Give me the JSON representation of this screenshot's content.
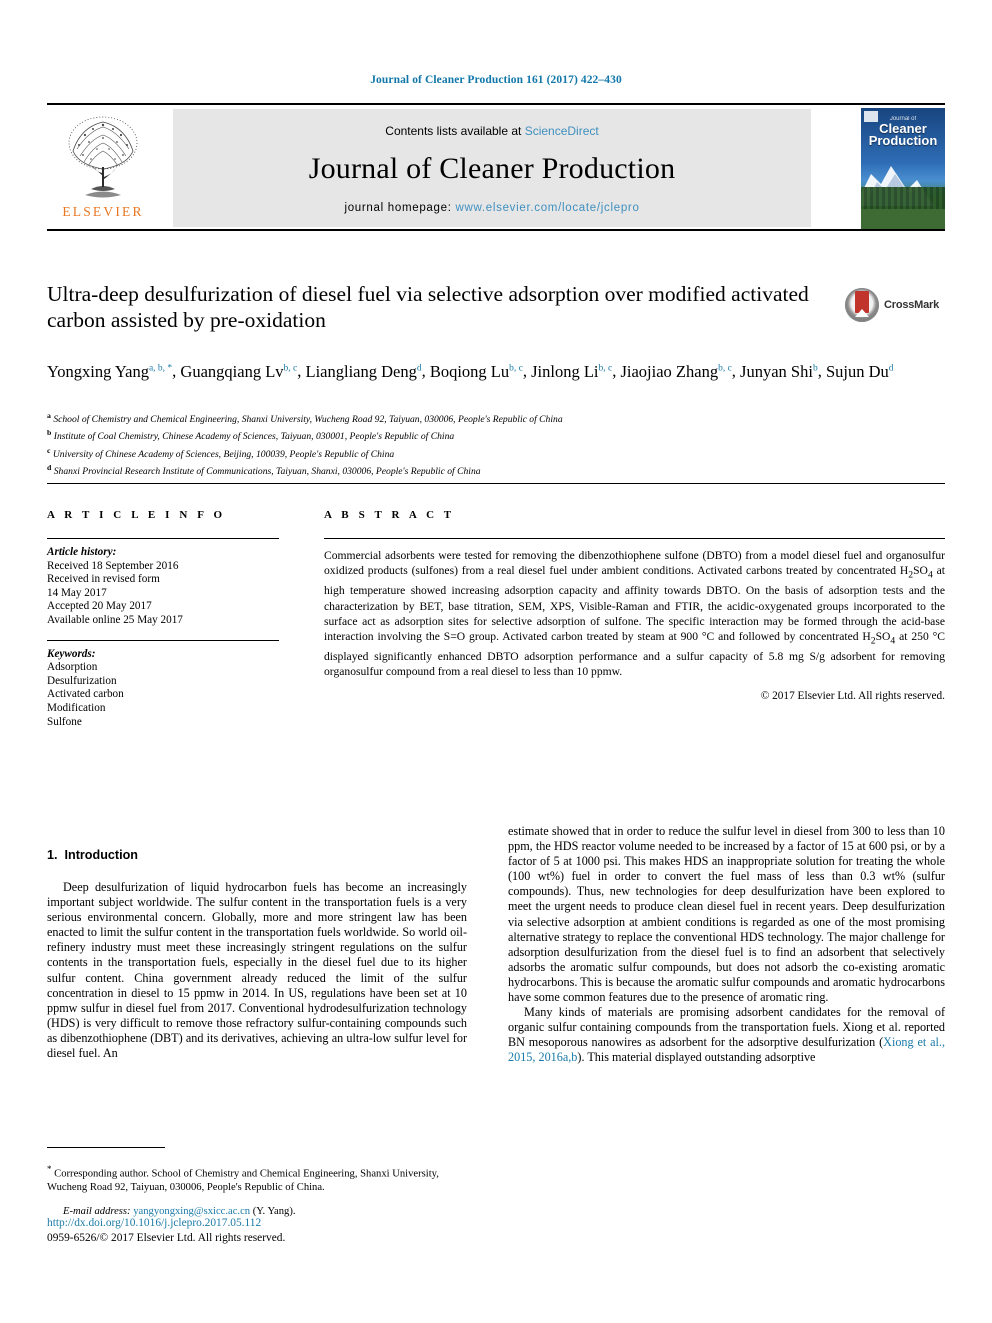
{
  "running_head": "Journal of Cleaner Production 161 (2017) 422–430",
  "masthead": {
    "contents_prefix": "Contents lists available at ",
    "sciencedirect": "ScienceDirect",
    "journal_name": "Journal of Cleaner Production",
    "homepage_prefix": "journal homepage: ",
    "homepage_url": "www.elsevier.com/locate/jclepro",
    "publisher": "ELSEVIER",
    "cover_kicker": "Journal of",
    "cover_title_line1": "Cleaner",
    "cover_title_line2": "Production"
  },
  "crossmark": {
    "label": "CrossMark"
  },
  "title": "Ultra-deep desulfurization of diesel fuel via selective adsorption over modified activated carbon assisted by pre-oxidation",
  "authors": [
    {
      "name": "Yongxing Yang",
      "marks": "a, b, *"
    },
    {
      "name": "Guangqiang Lv",
      "marks": "b, c"
    },
    {
      "name": "Liangliang Deng",
      "marks": "d"
    },
    {
      "name": "Boqiong Lu",
      "marks": "b, c"
    },
    {
      "name": "Jinlong Li",
      "marks": "b, c"
    },
    {
      "name": "Jiaojiao Zhang",
      "marks": "b, c"
    },
    {
      "name": "Junyan Shi",
      "marks": "b"
    },
    {
      "name": "Sujun Du",
      "marks": "d"
    }
  ],
  "affiliations": [
    {
      "mark": "a",
      "text": "School of Chemistry and Chemical Engineering, Shanxi University, Wucheng Road 92, Taiyuan, 030006, People's Republic of China"
    },
    {
      "mark": "b",
      "text": "Institute of Coal Chemistry, Chinese Academy of Sciences, Taiyuan, 030001, People's Republic of China"
    },
    {
      "mark": "c",
      "text": "University of Chinese Academy of Sciences, Beijing, 100039, People's Republic of China"
    },
    {
      "mark": "d",
      "text": "Shanxi Provincial Research Institute of Communications, Taiyuan, Shanxi, 030006, People's Republic of China"
    }
  ],
  "article_info": {
    "heading": "A R T I C L E   I N F O",
    "history_label": "Article history:",
    "history": [
      "Received 18 September 2016",
      "Received in revised form",
      "14 May 2017",
      "Accepted 20 May 2017",
      "Available online 25 May 2017"
    ],
    "keywords_label": "Keywords:",
    "keywords": [
      "Adsorption",
      "Desulfurization",
      "Activated carbon",
      "Modification",
      "Sulfone"
    ]
  },
  "abstract": {
    "heading": "A B S T R A C T",
    "body": "Commercial adsorbents were tested for removing the dibenzothiophene sulfone (DBTO) from a model diesel fuel and organosulfur oxidized products (sulfones) from a real diesel fuel under ambient conditions. Activated carbons treated by concentrated H2SO4 at high temperature showed increasing adsorption capacity and affinity towards DBTO. On the basis of adsorption tests and the characterization by BET, base titration, SEM, XPS, Visible-Raman and FTIR, the acidic-oxygenated groups incorporated to the surface act as adsorption sites for selective adsorption of sulfone. The specific interaction may be formed through the acid-base interaction involving the S=O group. Activated carbon treated by steam at 900 °C and followed by concentrated H2SO4 at 250 °C displayed significantly enhanced DBTO adsorption performance and a sulfur capacity of 5.8 mg S/g adsorbent for removing organosulfur compound from a real diesel to less than 10 ppmw.",
    "copyright": "© 2017 Elsevier Ltd. All rights reserved."
  },
  "section": {
    "number": "1.",
    "title": "Introduction"
  },
  "body": {
    "left_paragraph_1": "Deep desulfurization of liquid hydrocarbon fuels has become an increasingly important subject worldwide. The sulfur content in the transportation fuels is a very serious environmental concern. Globally, more and more stringent law has been enacted to limit the sulfur content in the transportation fuels worldwide. So world oil-refinery industry must meet these increasingly stringent regulations on the sulfur contents in the transportation fuels, especially in the diesel fuel due to its higher sulfur content. China government already reduced the limit of the sulfur concentration in diesel to 15 ppmw in 2014. In US, regulations have been set at 10 ppmw sulfur in diesel fuel from 2017. Conventional hydrodesulfurization technology (HDS) is very difficult to remove those refractory sulfur-containing compounds such as dibenzothiophene (DBT) and its derivatives, achieving an ultra-low sulfur level for diesel fuel. An",
    "right_paragraph_1": "estimate showed that in order to reduce the sulfur level in diesel from 300 to less than 10 ppm, the HDS reactor volume needed to be increased by a factor of 15 at 600 psi, or by a factor of 5 at 1000 psi. This makes HDS an inappropriate solution for treating the whole (100 wt%) fuel in order to convert the fuel mass of less than 0.3 wt% (sulfur compounds). Thus, new technologies for deep desulfurization have been explored to meet the urgent needs to produce clean diesel fuel in recent years. Deep desulfurization via selective adsorption at ambient conditions is regarded as one of the most promising alternative strategy to replace the conventional HDS technology. The major challenge for adsorption desulfurization from the diesel fuel is to find an adsorbent that selectively adsorbs the aromatic sulfur compounds, but does not adsorb the co-existing aromatic hydrocarbons. This is because the aromatic sulfur compounds and aromatic hydrocarbons have some common features due to the presence of aromatic ring.",
    "right_paragraph_2_pre": "Many kinds of materials are promising adsorbent candidates for the removal of organic sulfur containing compounds from the transportation fuels. Xiong et al. reported BN mesoporous nanowires as adsorbent for the adsorptive desulfurization (",
    "right_paragraph_2_link": "Xiong et al., 2015, 2016a,b",
    "right_paragraph_2_post": "). This material displayed outstanding adsorptive"
  },
  "footnote": {
    "star": "*",
    "corresponding": " Corresponding author. School of Chemistry and Chemical Engineering, Shanxi University, Wucheng Road 92, Taiyuan, 030006, People's Republic of China.",
    "email_label": "E-mail address:",
    "email": "yangyongxing@sxicc.ac.cn",
    "email_suffix": "(Y. Yang)."
  },
  "doi": {
    "url": "http://dx.doi.org/10.1016/j.jclepro.2017.05.112",
    "issn_line": "0959-6526/© 2017 Elsevier Ltd. All rights reserved."
  },
  "colors": {
    "link": "#1a7aa8",
    "accent_orange": "#e87722",
    "masthead_bg": "#e6e6e6"
  }
}
